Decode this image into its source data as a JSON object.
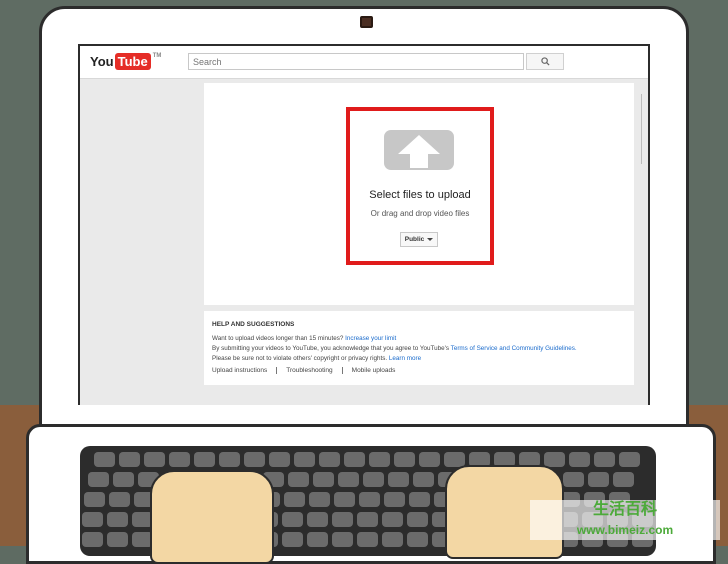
{
  "masthead": {
    "logo_you": "You",
    "logo_tube": "Tube",
    "logo_tm": "TM",
    "search_placeholder": "Search",
    "search_icon": "magnifier"
  },
  "upload": {
    "title": "Select files to upload",
    "subtitle": "Or drag and drop video files",
    "privacy_value": "Public",
    "upload_icon": "cloud-up-arrow",
    "highlight_color": "#e01b1b"
  },
  "help": {
    "heading": "HELP AND SUGGESTIONS",
    "line1_text": "Want to upload videos longer than 15 minutes?",
    "line1_link": "Increase your limit",
    "line2_text": "By submitting your videos to YouTube, you acknowledge that you agree to YouTube's",
    "line2_link": "Terms of Service and Community Guidelines.",
    "line3_text": "Please be sure not to violate others' copyright or privacy rights.",
    "line3_link": "Learn more",
    "links": [
      "Upload instructions",
      "Troubleshooting",
      "Mobile uploads"
    ]
  },
  "watermark": {
    "cn": "生活百科",
    "url": "www.bimeiz.com"
  }
}
